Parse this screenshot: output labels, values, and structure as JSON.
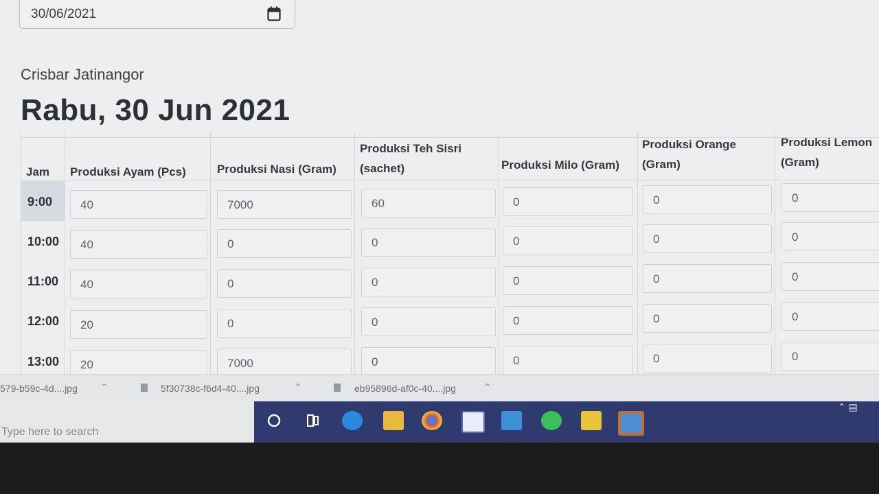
{
  "date_input": {
    "value": "30/06/2021",
    "icon": "calendar-icon"
  },
  "store_name": "Crisbar Jatinangor",
  "day_title": "Rabu, 30 Jun 2021",
  "table": {
    "headers": [
      [
        "Jam"
      ],
      [
        "Produksi Ayam (Pcs)"
      ],
      [
        "Produksi Nasi (Gram)"
      ],
      [
        "Produksi Teh Sisri",
        "(sachet)"
      ],
      [
        "Produksi Milo (Gram)"
      ],
      [
        "Produksi Orange",
        "(Gram)"
      ],
      [
        "Produksi Lemon",
        "(Gram)"
      ]
    ],
    "rows": [
      {
        "time": "9:00",
        "values": [
          "40",
          "7000",
          "60",
          "0",
          "0",
          "0"
        ]
      },
      {
        "time": "10:00",
        "values": [
          "40",
          "0",
          "0",
          "0",
          "0",
          "0"
        ]
      },
      {
        "time": "11:00",
        "values": [
          "40",
          "0",
          "0",
          "0",
          "0",
          "0"
        ]
      },
      {
        "time": "12:00",
        "values": [
          "20",
          "0",
          "0",
          "0",
          "0",
          "0"
        ]
      },
      {
        "time": "13:00",
        "values": [
          "20",
          "7000",
          "0",
          "0",
          "0",
          "0"
        ]
      }
    ]
  },
  "downloads": [
    "579-b59c-4d....jpg",
    "5f30738c-f6d4-40....jpg",
    "eb95896d-af0c-40....jpg"
  ],
  "taskbar": {
    "search_placeholder": "Type here to search",
    "icons": [
      "cortana-icon",
      "task-view-icon",
      "edge-icon",
      "file-explorer-icon",
      "chrome-icon",
      "store-icon",
      "mail-icon",
      "whatsapp-icon",
      "sticky-notes-icon",
      "photos-icon"
    ]
  },
  "colors": {
    "taskbar": "#2f3a6e",
    "page_bg": "#eceeef"
  }
}
